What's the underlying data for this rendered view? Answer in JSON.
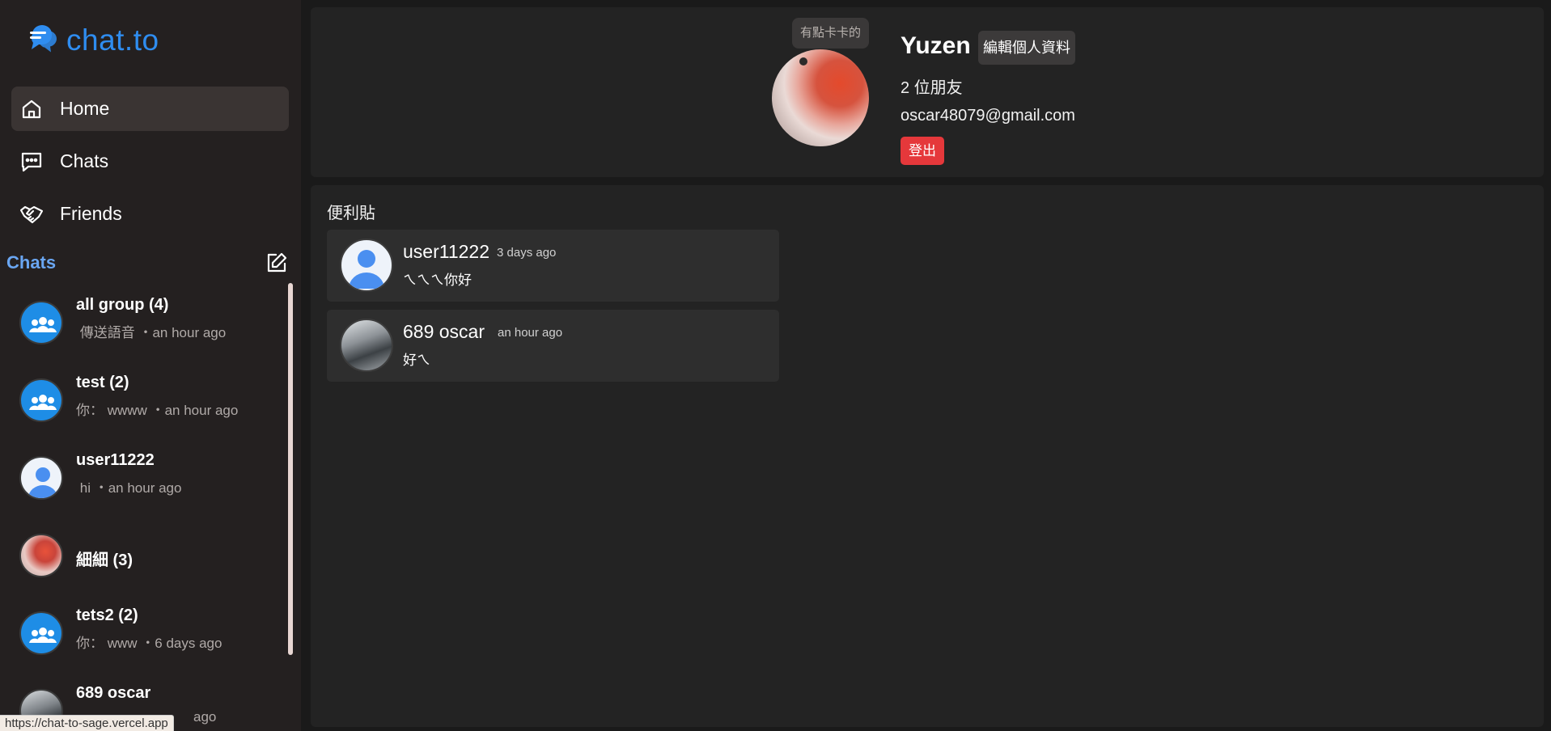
{
  "brand": {
    "name": "chat.to",
    "accent": "#2f8df0"
  },
  "nav": [
    {
      "label": "Home",
      "icon": "home-icon",
      "active": true
    },
    {
      "label": "Chats",
      "icon": "chat-bubble-icon",
      "active": false
    },
    {
      "label": "Friends",
      "icon": "handshake-icon",
      "active": false
    }
  ],
  "chats_section": {
    "title": "Chats",
    "compose_icon": "edit-icon"
  },
  "chats": [
    {
      "name": "all group (4)",
      "preview": "傳送語音",
      "time": "an hour ago",
      "avatar": "group-icon"
    },
    {
      "name": "test (2)",
      "preview": "你： wwww",
      "time": "an hour ago",
      "avatar": "group-icon"
    },
    {
      "name": "user11222",
      "preview": "hi",
      "time": "an hour ago",
      "avatar": "default-user"
    },
    {
      "name": "細細 (3)",
      "preview": "",
      "time": "",
      "avatar": "photo-red"
    },
    {
      "name": "tets2 (2)",
      "preview": "你： www",
      "time": "6 days ago",
      "avatar": "group-icon"
    },
    {
      "name": "689 oscar",
      "preview": "",
      "time": "ago",
      "avatar": "photo-gray"
    }
  ],
  "status_bar": {
    "url": "https://chat-to-sage.vercel.app"
  },
  "profile": {
    "status": "有點卡卡的",
    "name": "Yuzen",
    "edit_label": "編輯個人資料",
    "friends": "2 位朋友",
    "email": "oscar48079@gmail.com",
    "logout_label": "登出",
    "logout_color": "#e5383b"
  },
  "sticky": {
    "title": "便利貼",
    "notes": [
      {
        "name": "user11222",
        "time": "3 days ago",
        "message": "ㄟㄟㄟ你好",
        "avatar": "default-user"
      },
      {
        "name": "689 oscar",
        "time": "an hour ago",
        "message": "好ㄟ",
        "avatar": "photo-gray"
      }
    ]
  }
}
